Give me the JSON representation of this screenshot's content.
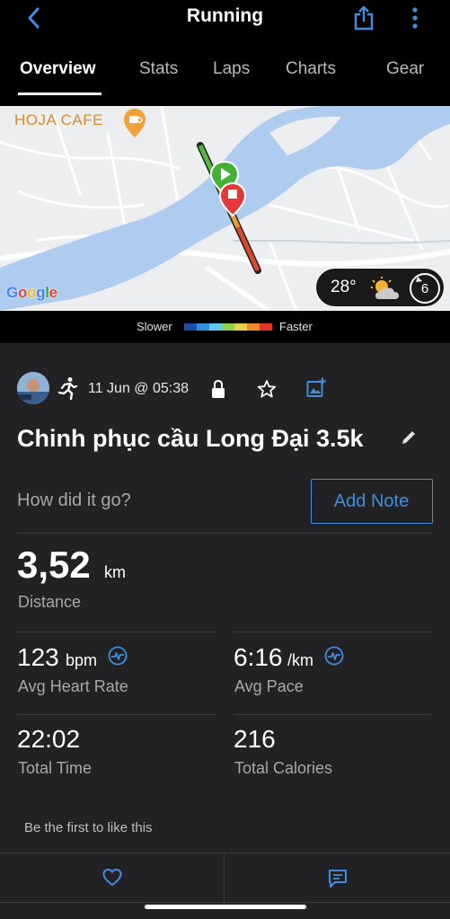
{
  "header": {
    "title": "Running",
    "tabs": [
      {
        "label": "Overview",
        "active": true
      },
      {
        "label": "Stats",
        "active": false
      },
      {
        "label": "Laps",
        "active": false
      },
      {
        "label": "Charts",
        "active": false
      },
      {
        "label": "Gear",
        "active": false
      }
    ],
    "icons": {
      "back": "chevron-left-icon",
      "share": "share-icon",
      "more": "more-vertical-icon"
    }
  },
  "map": {
    "poi_label": "HOJA CAFE",
    "provider": "Google",
    "weather": {
      "temperature": "28°",
      "condition": "partly-cloudy-icon",
      "wind": "6"
    }
  },
  "legend": {
    "slower": "Slower",
    "faster": "Faster",
    "colors": [
      "#1b4fb0",
      "#2f8fe0",
      "#5fc7e8",
      "#8fd04a",
      "#e8d24a",
      "#ef8a2a",
      "#e3342a"
    ]
  },
  "activity": {
    "date": "11 Jun @ 05:38",
    "title": "Chinh phục cầu Long Đại 3.5k",
    "note_prompt": "How did it go?",
    "add_note": "Add Note",
    "icons": {
      "activity_type": "running-icon",
      "privacy": "lock-icon",
      "favorite": "star-icon",
      "add_photo": "add-photo-icon",
      "edit": "pencil-icon"
    }
  },
  "stats": {
    "distance": {
      "value": "3,52",
      "unit": "km",
      "label": "Distance"
    },
    "heart_rate": {
      "value": "123",
      "unit": "bpm",
      "label": "Avg Heart Rate"
    },
    "pace": {
      "value": "6:16",
      "unit": "/km",
      "label": "Avg Pace"
    },
    "time": {
      "value": "22:02",
      "label": "Total Time"
    },
    "calories": {
      "value": "216",
      "label": "Total Calories"
    }
  },
  "social": {
    "likes_text": "Be the first to like this",
    "icons": {
      "like": "heart-icon",
      "comment": "comment-icon"
    }
  },
  "colors": {
    "accent": "#3f8ee0",
    "card_bg": "#222224",
    "label": "#a8a8a8"
  }
}
